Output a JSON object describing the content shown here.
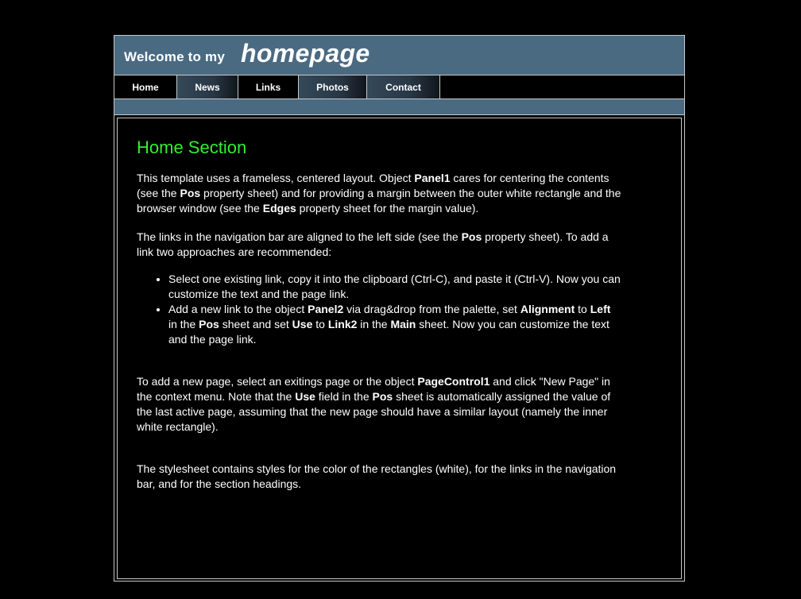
{
  "header": {
    "welcome": "Welcome to my",
    "homepage": "homepage"
  },
  "nav": [
    {
      "label": "Home"
    },
    {
      "label": "News"
    },
    {
      "label": "Links"
    },
    {
      "label": "Photos"
    },
    {
      "label": "Contact"
    }
  ],
  "colors": {
    "header_bg": "#4a6a82",
    "heading": "#33ee33",
    "page_bg": "#000000",
    "border": "#c8c8c8"
  },
  "content": {
    "title": "Home Section",
    "p1": [
      {
        "t": "This template uses a frameless, centered layout. Object "
      },
      {
        "t": "Panel1",
        "b": true
      },
      {
        "t": " cares for centering the contents (see the "
      },
      {
        "t": "Pos",
        "b": true
      },
      {
        "t": " property sheet) and for providing a margin between the outer white rectangle and the browser window (see the "
      },
      {
        "t": "Edges",
        "b": true
      },
      {
        "t": " property sheet for the margin value)."
      }
    ],
    "p2": [
      {
        "t": "The links in the navigation bar are aligned to the left side (see the "
      },
      {
        "t": "Pos",
        "b": true
      },
      {
        "t": " property sheet). To add a link two approaches are recommended:"
      }
    ],
    "li1": [
      {
        "t": "Select one existing link, copy it into the clipboard (Ctrl-C), and paste it (Ctrl-V). Now you can customize the text and the page link."
      }
    ],
    "li2": [
      {
        "t": "Add a new link to the object "
      },
      {
        "t": "Panel2",
        "b": true
      },
      {
        "t": " via drag&drop from the palette, set "
      },
      {
        "t": "Alignment",
        "b": true
      },
      {
        "t": " to "
      },
      {
        "t": "Left",
        "b": true
      },
      {
        "t": " in the "
      },
      {
        "t": "Pos",
        "b": true
      },
      {
        "t": " sheet and set "
      },
      {
        "t": "Use",
        "b": true
      },
      {
        "t": " to "
      },
      {
        "t": "Link2",
        "b": true
      },
      {
        "t": " in the "
      },
      {
        "t": "Main",
        "b": true
      },
      {
        "t": " sheet. Now you can customize the text and the page link."
      }
    ],
    "p3": [
      {
        "t": "To add a new page, select an exitings page or the object "
      },
      {
        "t": "PageControl1",
        "b": true
      },
      {
        "t": " and click \"New Page\" in the context menu. Note that the "
      },
      {
        "t": "Use",
        "b": true
      },
      {
        "t": " field in the "
      },
      {
        "t": "Pos",
        "b": true
      },
      {
        "t": " sheet is automatically assigned the value of the last active page, assuming that the new page should have a similar layout (namely the inner white rectangle)."
      }
    ],
    "p4": [
      {
        "t": "The stylesheet contains styles for the color of the rectangles (white), for the links in the navigation bar, and for the section headings."
      }
    ]
  }
}
